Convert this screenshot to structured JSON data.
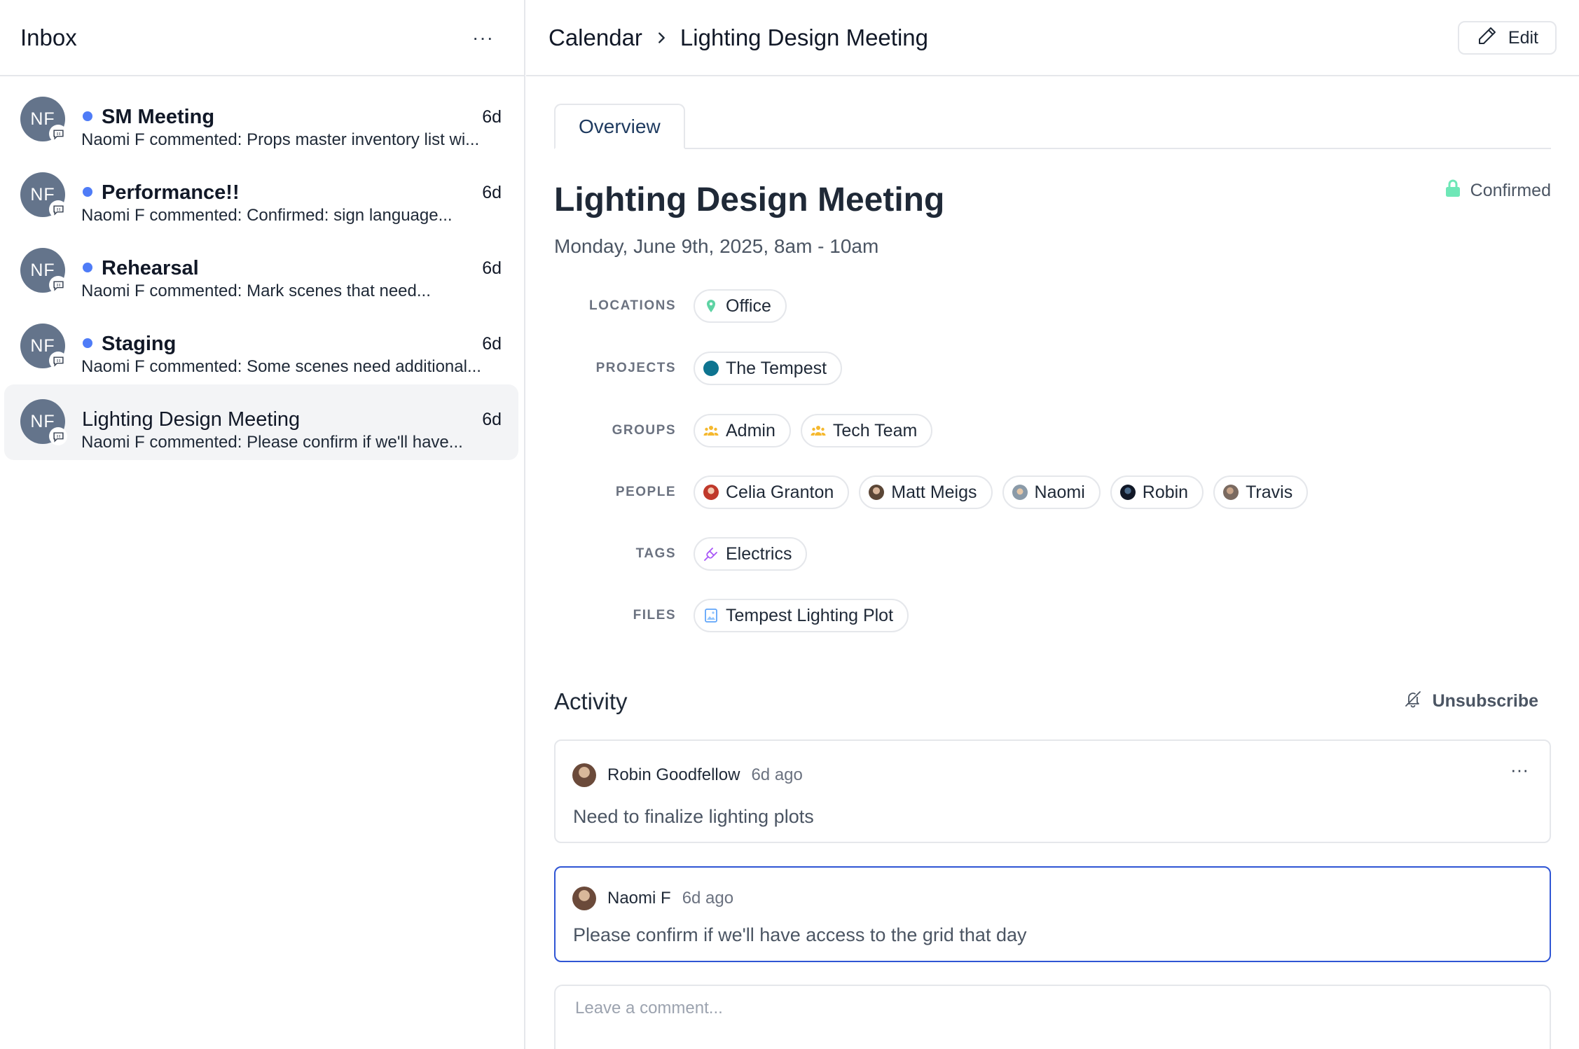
{
  "inbox": {
    "title": "Inbox",
    "more_label": "···",
    "items": [
      {
        "initials": "NF",
        "title": "SM Meeting",
        "time": "6d",
        "preview": "Naomi F commented: Props master inventory list wi...",
        "unread": true
      },
      {
        "initials": "NF",
        "title": "Performance!!",
        "time": "6d",
        "preview": "Naomi F commented: Confirmed: sign language...",
        "unread": true
      },
      {
        "initials": "NF",
        "title": "Rehearsal",
        "time": "6d",
        "preview": "Naomi F commented: Mark scenes that need...",
        "unread": true
      },
      {
        "initials": "NF",
        "title": "Staging",
        "time": "6d",
        "preview": "Naomi F commented: Some scenes need additional...",
        "unread": true
      },
      {
        "initials": "NF",
        "title": "Lighting Design Meeting",
        "time": "6d",
        "preview": "Naomi F commented: Please confirm if we'll have...",
        "unread": false
      }
    ]
  },
  "header": {
    "breadcrumb_root": "Calendar",
    "breadcrumb_current": "Lighting Design Meeting",
    "edit_label": "Edit"
  },
  "tabs": {
    "overview": "Overview"
  },
  "event": {
    "title": "Lighting Design Meeting",
    "status": "Confirmed",
    "date": "Monday, June 9th, 2025, 8am - 10am"
  },
  "fields": {
    "locations": {
      "label": "LOCATIONS",
      "items": [
        "Office"
      ]
    },
    "projects": {
      "label": "PROJECTS",
      "items": [
        "The Tempest"
      ]
    },
    "groups": {
      "label": "GROUPS",
      "items": [
        "Admin",
        "Tech Team"
      ]
    },
    "people": {
      "label": "PEOPLE",
      "items": [
        "Celia Granton",
        "Matt Meigs",
        "Naomi",
        "Robin",
        "Travis"
      ]
    },
    "tags": {
      "label": "TAGS",
      "items": [
        "Electrics"
      ]
    },
    "files": {
      "label": "FILES",
      "items": [
        "Tempest Lighting Plot"
      ]
    }
  },
  "activity": {
    "title": "Activity",
    "unsubscribe_label": "Unsubscribe",
    "comments": [
      {
        "author": "Robin Goodfellow",
        "time": "6d ago",
        "body": "Need to finalize lighting plots"
      },
      {
        "author": "Naomi F",
        "time": "6d ago",
        "body": "Please confirm if we'll have access to the grid that day"
      }
    ],
    "comment_more_label": "···",
    "comment_placeholder": "Leave a comment..."
  },
  "colors": {
    "unread_dot": "#4f7cf7",
    "avatar_bg": "#64748b",
    "confirmed_lock": "#6ee7b7",
    "project_dot": "#0e7490",
    "group_icon": "#f5b82e",
    "tag_icon": "#a855f7",
    "active_comment_border": "#2f55d4"
  },
  "icons": {
    "inbox_badge": "comment-icon",
    "breadcrumb_separator": "chevron-right-icon",
    "edit": "pencil-icon",
    "status": "lock-icon",
    "location": "map-pin-icon",
    "group": "users-icon",
    "tag": "plug-icon",
    "file": "image-file-icon",
    "unsubscribe": "bell-off-icon"
  }
}
